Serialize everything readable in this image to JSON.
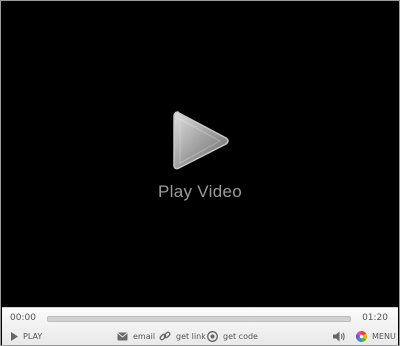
{
  "stage": {
    "play_label": "Play Video"
  },
  "controls": {
    "elapsed": "00:00",
    "total": "01:20",
    "progress": 0,
    "play_label": "PLAY",
    "email_label": "email",
    "link_label": "get link",
    "code_label": "get code",
    "menu_label": "MENU"
  },
  "icons": {
    "big_play": "play-triangle-icon",
    "play": "play-icon",
    "email": "envelope-icon",
    "link": "chain-link-icon",
    "code": "embed-code-icon",
    "volume": "speaker-icon",
    "menu": "color-wheel-icon"
  }
}
